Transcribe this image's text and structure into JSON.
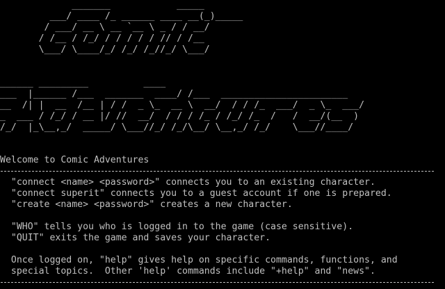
{
  "colors": {
    "background": "#000000",
    "foreground": "#c0c0c0"
  },
  "banner": {
    "comic": "             _______            _____\n         ___/ ____ /_ ______ ____ __(_)_____\n        / ___/ __ \\ __ `__ \\ _ / / __/\n       / /__ / /_/ / / / / / // / /__\n       \\___/ \\____/_/ /_/ /_//_/ \\___/",
    "adventures": "______ _________          ____\n___  |______ /___  _______  ____/ /___  _______________________\n__  /| |  __  /__ | / /  _ \\_  __ \\  __/  / / /_  ___/  _ \\_  ___/\n_  ___ / /_/ / __ |/ //  __/  / / / /_ / /_/ /_  /   /  __/(__  )\n/_/  |_\\__,_/  _____/ \\___//_/ /_/\\__/ \\__,_/ /_/    \\___//____/"
  },
  "welcome": "Welcome to Comic Adventures",
  "lines": {
    "connect_name": "  \"connect <name> <password>\" connects you to an existing character.",
    "connect_guest": "  \"connect superit\" connects you to a guest account if one is prepared.",
    "create": "  \"create <name> <password>\" creates a new character.",
    "who": "  \"WHO\" tells you who is logged in to the game (case sensitive).",
    "quit": "  \"QUIT\" exits the game and saves your character.",
    "help_1": "  Once logged on, \"help\" gives help on specific commands, functions, and",
    "help_2": "  special topics.  Other 'help' commands include \"+help\" and \"news\"."
  }
}
